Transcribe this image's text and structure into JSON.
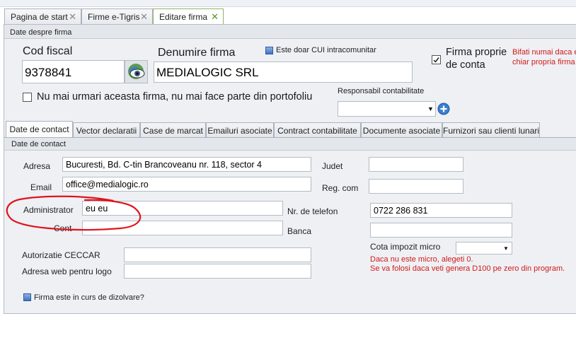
{
  "tabs": [
    {
      "label": "Pagina de start",
      "close": "✕"
    },
    {
      "label": "Firme e-Tigris",
      "close": "✕"
    },
    {
      "label": "Editare firma",
      "close": "✕"
    }
  ],
  "section_header": "Date despre firma",
  "firm": {
    "cod_fiscal_label": "Cod fiscal",
    "cod_fiscal_value": "9378841",
    "denumire_label": "Denumire firma",
    "denumire_value": "MEDIALOGIC SRL",
    "cui_intracom_label": "Este doar CUI intracomunitar",
    "firma_proprie_label_1": "Firma proprie",
    "firma_proprie_label_2": "de conta",
    "firma_proprie_hint_1": "Bifati numai daca e",
    "firma_proprie_hint_2": "chiar propria firma d",
    "nu_mai_urmari_label": "Nu mai urmari aceasta firma, nu mai face parte din portofoliu",
    "responsabil_label": "Responsabil contabilitate",
    "responsabil_value": ""
  },
  "subtabs": [
    "Date de contact",
    "Vector declaratii",
    "Case de marcat",
    "Emailuri asociate",
    "Contract contabilitate",
    "Documente asociate",
    "Furnizori sau clienti lunari"
  ],
  "contact": {
    "header": "Date de contact",
    "adresa_label": "Adresa",
    "adresa_value": "Bucuresti, Bd. C-tin Brancoveanu nr. 118, sector 4",
    "judet_label": "Judet",
    "judet_value": "",
    "email_label": "Email",
    "email_value": "office@medialogic.ro",
    "regcom_label": "Reg. com",
    "regcom_value": "",
    "administrator_label": "Administrator",
    "administrator_value": "eu eu",
    "telefon_label": "Nr. de telefon",
    "telefon_value": "0722 286 831",
    "cont_label": "Cont",
    "cont_value": "",
    "banca_label": "Banca",
    "banca_value": "",
    "cota_label": "Cota impozit micro",
    "cota_value": "",
    "cota_hint_1": "Daca nu este micro, alegeti 0.",
    "cota_hint_2": "Se va folosi daca veti genera  D100 pe zero din program.",
    "ceccar_label": "Autorizatie CECCAR",
    "ceccar_value": "",
    "logo_label": "Adresa web pentru logo",
    "logo_value": "",
    "dizolvare_label": "Firma este in curs de dizolvare?"
  },
  "colors": {
    "active_tab_border": "#8fb36a",
    "hint_red": "#d11a1a",
    "annotation_red": "#e0141e",
    "panel_bg": "#eef0f4"
  },
  "icons": {
    "lookup": "eye-globe-icon",
    "add": "plus-circle-icon",
    "dropdown": "chevron-down-icon"
  }
}
